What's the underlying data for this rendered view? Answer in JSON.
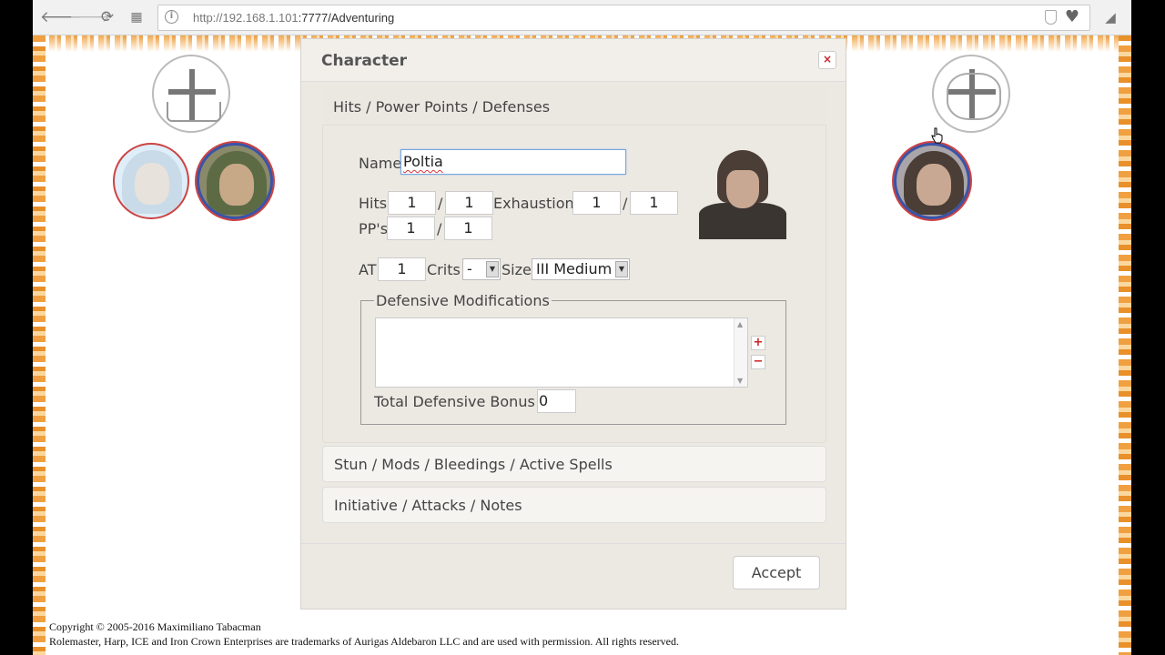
{
  "browser": {
    "url_host": "http://192.168.1.101",
    "url_rest": ":7777/Adventuring"
  },
  "dialog": {
    "title": "Character",
    "close_label": "×",
    "sections": {
      "hits": "Hits / Power Points / Defenses",
      "stun": "Stun / Mods / Bleedings / Active Spells",
      "initiative": "Initiative / Attacks / Notes"
    },
    "name_label": "Name",
    "name_value": "Poltia",
    "hits_label": "Hits",
    "hits_current": "1",
    "hits_max": "1",
    "slash": "/",
    "exhaustion_label": "Exhaustion",
    "exhaustion_current": "1",
    "exhaustion_max": "1",
    "pp_label": "PP's",
    "pp_current": "1",
    "pp_max": "1",
    "at_label": "AT",
    "at_value": "1",
    "crits_label": "Crits",
    "crits_value": "-",
    "size_label": "Size",
    "size_value": "III Medium",
    "defmod_legend": "Defensive Modifications",
    "add_label": "+",
    "remove_label": "−",
    "total_def_label": "Total Defensive Bonus",
    "total_def_value": "0",
    "accept_label": "Accept"
  },
  "footer": {
    "line1": "Copyright © 2005-2016 Maximiliano Tabacman",
    "line2": "Rolemaster, Harp, ICE and Iron Crown Enterprises are trademarks of Aurigas Aldebaron LLC and are used with permission. All rights reserved."
  }
}
